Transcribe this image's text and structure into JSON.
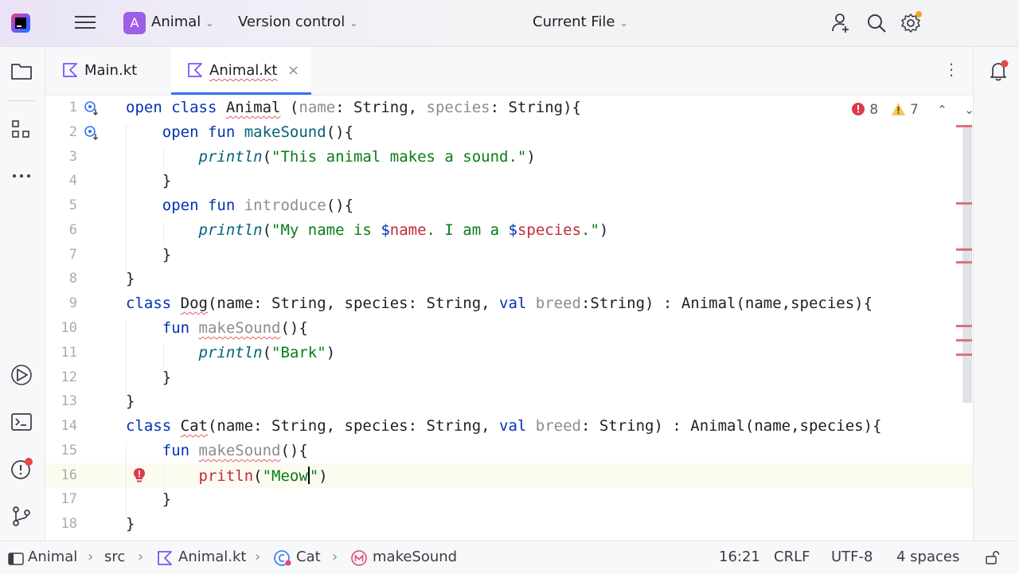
{
  "titlebar": {
    "project_badge": "A",
    "project_name": "Animal",
    "vcs_label": "Version control",
    "run_config": "Current File",
    "icons": [
      "hamburger-menu-icon",
      "add-user-icon",
      "search-icon",
      "settings-icon"
    ]
  },
  "tabs": [
    {
      "label": "Main.kt",
      "active": false
    },
    {
      "label": "Animal.kt",
      "active": true
    }
  ],
  "inspections": {
    "errors": "8",
    "warnings": "7"
  },
  "line_numbers": [
    "1",
    "2",
    "3",
    "4",
    "5",
    "6",
    "7",
    "8",
    "9",
    "10",
    "11",
    "12",
    "13",
    "14",
    "15",
    "16",
    "17",
    "18"
  ],
  "code": {
    "l1": [
      "open ",
      "class ",
      "Animal",
      " (",
      "name",
      ": String, ",
      "species",
      ": String){"
    ],
    "l2": [
      "    ",
      "open ",
      "fun ",
      "makeSound",
      "(){"
    ],
    "l3": [
      "        ",
      "println",
      "(",
      "\"This animal makes a sound.\"",
      ")"
    ],
    "l4": [
      "    }"
    ],
    "l5": [
      "    ",
      "open ",
      "fun ",
      "introduce",
      "(){"
    ],
    "l6": [
      "        ",
      "println",
      "(",
      "\"My name is ",
      "$",
      "name",
      ". I am a ",
      "$",
      "species",
      ".\"",
      ")"
    ],
    "l7": [
      "    }"
    ],
    "l8": [
      "}"
    ],
    "l9": [
      "class ",
      "Dog",
      "(name: String, species: String, ",
      "val ",
      "breed",
      ":String) : Animal(name,species){"
    ],
    "l10": [
      "    ",
      "fun ",
      "makeSound",
      "(){"
    ],
    "l11": [
      "        ",
      "println",
      "(",
      "\"Bark\"",
      ")"
    ],
    "l12": [
      "    }"
    ],
    "l13": [
      "}"
    ],
    "l14": [
      "class ",
      "Cat",
      "(name: String, species: String, ",
      "val ",
      "breed",
      ": String) : Animal(name,species){"
    ],
    "l15": [
      "    ",
      "fun ",
      "makeSound",
      "(){"
    ],
    "l16": [
      "        ",
      "pritln",
      "(",
      "\"Meow",
      "\"",
      ")"
    ],
    "l17": [
      "    }"
    ],
    "l18": [
      "}"
    ]
  },
  "statusbar": {
    "breadcrumbs": [
      "Animal",
      "src",
      "Animal.kt",
      "Cat",
      "makeSound"
    ],
    "position": "16:21",
    "line_ending": "CRLF",
    "encoding": "UTF-8",
    "indent": "4 spaces"
  },
  "colors": {
    "accent": "#3574f0",
    "keyword": "#0033b3",
    "string": "#067d17",
    "error": "#c22b35",
    "warning": "#e8a33d",
    "project_badge": "#9d5ee8"
  }
}
